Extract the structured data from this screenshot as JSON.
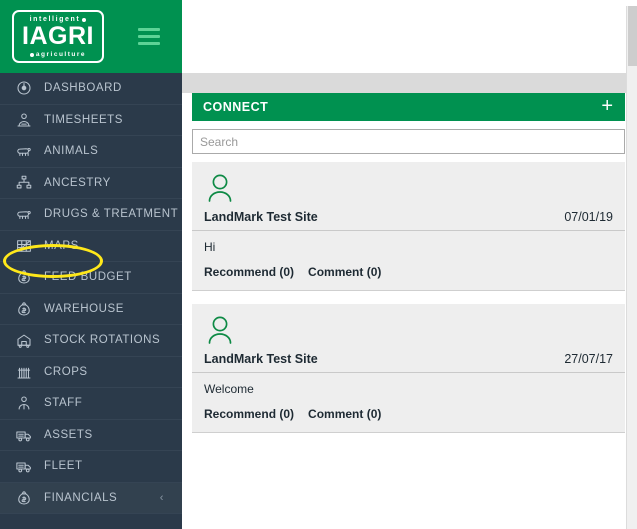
{
  "brand": {
    "logo_top": "intelligent",
    "logo_main": "IAGRI",
    "logo_bottom": "agriculture",
    "menu_toggle_name": "hamburger-menu",
    "green": "#009150",
    "sidebar_bg": "#2b3a4a"
  },
  "sidebar": {
    "items": [
      {
        "label": "DASHBOARD",
        "icon": "gauge-icon",
        "active": false,
        "chevron": ""
      },
      {
        "label": "TIMESHEETS",
        "icon": "person-clock-icon",
        "active": false,
        "chevron": ""
      },
      {
        "label": "ANIMALS",
        "icon": "sheep-icon",
        "active": false,
        "chevron": ""
      },
      {
        "label": "ANCESTRY",
        "icon": "tree-icon",
        "active": false,
        "chevron": ""
      },
      {
        "label": "DRUGS & TREATMENT",
        "icon": "sheep-icon",
        "active": false,
        "chevron": ""
      },
      {
        "label": "MAPS",
        "icon": "map-icon",
        "active": false,
        "chevron": ""
      },
      {
        "label": "FEED BUDGET",
        "icon": "money-bag-icon",
        "active": false,
        "chevron": ""
      },
      {
        "label": "WAREHOUSE",
        "icon": "money-bag-icon",
        "active": false,
        "chevron": ""
      },
      {
        "label": "STOCK ROTATIONS",
        "icon": "barn-icon",
        "active": false,
        "chevron": ""
      },
      {
        "label": "CROPS",
        "icon": "crops-icon",
        "active": false,
        "chevron": ""
      },
      {
        "label": "STAFF",
        "icon": "person-icon",
        "active": false,
        "chevron": ""
      },
      {
        "label": "ASSETS",
        "icon": "truck-icon",
        "active": false,
        "chevron": ""
      },
      {
        "label": "FLEET",
        "icon": "truck-icon",
        "active": false,
        "chevron": ""
      },
      {
        "label": "FINANCIALS",
        "icon": "money-bag-icon",
        "active": true,
        "chevron": "‹"
      }
    ],
    "highlight": {
      "target_label": "MAPS",
      "color": "#ffe81a",
      "shape": "ellipse"
    }
  },
  "panel": {
    "title": "CONNECT",
    "add_label": "+",
    "search": {
      "placeholder": "Search",
      "value": ""
    },
    "posts": [
      {
        "author": "LandMark Test Site",
        "date": "07/01/19",
        "text": "Hi",
        "recommend_label": "Recommend (0)",
        "comment_label": "Comment (0)",
        "avatar": "person-avatar-icon"
      },
      {
        "author": "LandMark Test Site",
        "date": "27/07/17",
        "text": "Welcome",
        "recommend_label": "Recommend (0)",
        "comment_label": "Comment (0)",
        "avatar": "person-avatar-icon"
      }
    ]
  }
}
